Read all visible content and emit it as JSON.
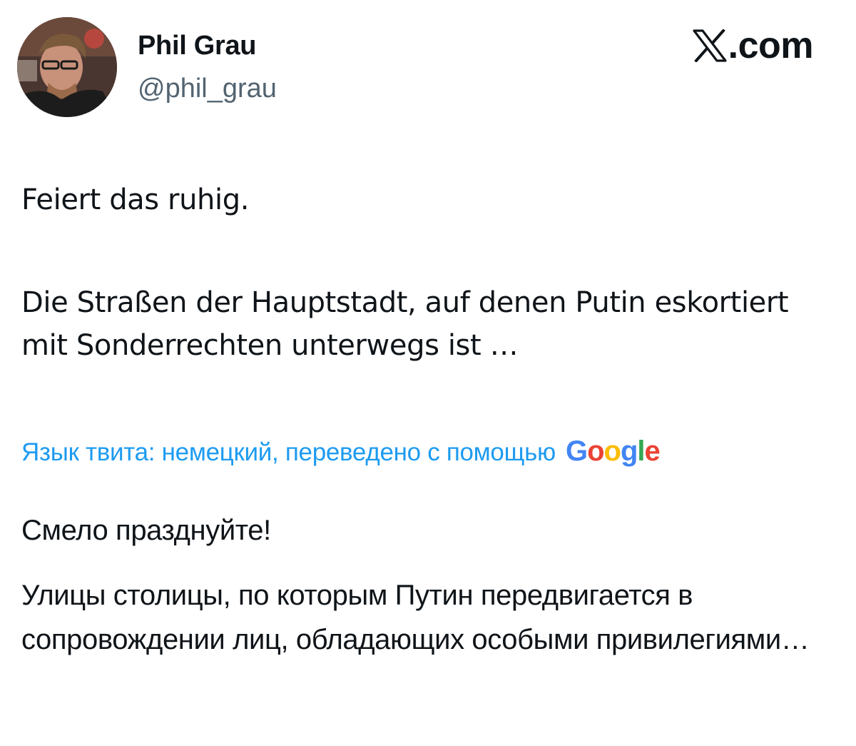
{
  "author": {
    "name": "Phil Grau",
    "handle": "@phil_grau"
  },
  "brand": {
    "logo_icon": "x-logo-icon",
    "text": ".com"
  },
  "tweet": {
    "original_line1": "Feiert das ruhig.",
    "original_line2": "Die Straßen der Hauptstadt, auf denen Putin eskortiert mit Sonderrechten unterwegs ist …"
  },
  "translation": {
    "note": "Язык твита: немецкий, переведено с помощью",
    "provider": "Google",
    "provider_colors": [
      "#4285f4",
      "#ea4335",
      "#fbbc05",
      "#4285f4",
      "#34a853",
      "#ea4335"
    ],
    "translated_line1": "Смело празднуйте!",
    "translated_line2": "Улицы столицы, по которым Путин передвигается в сопровождении лиц, обладающих особыми привилегиями…"
  },
  "colors": {
    "text_primary": "#0f1419",
    "text_secondary": "#536471",
    "link": "#1d9bf0"
  }
}
